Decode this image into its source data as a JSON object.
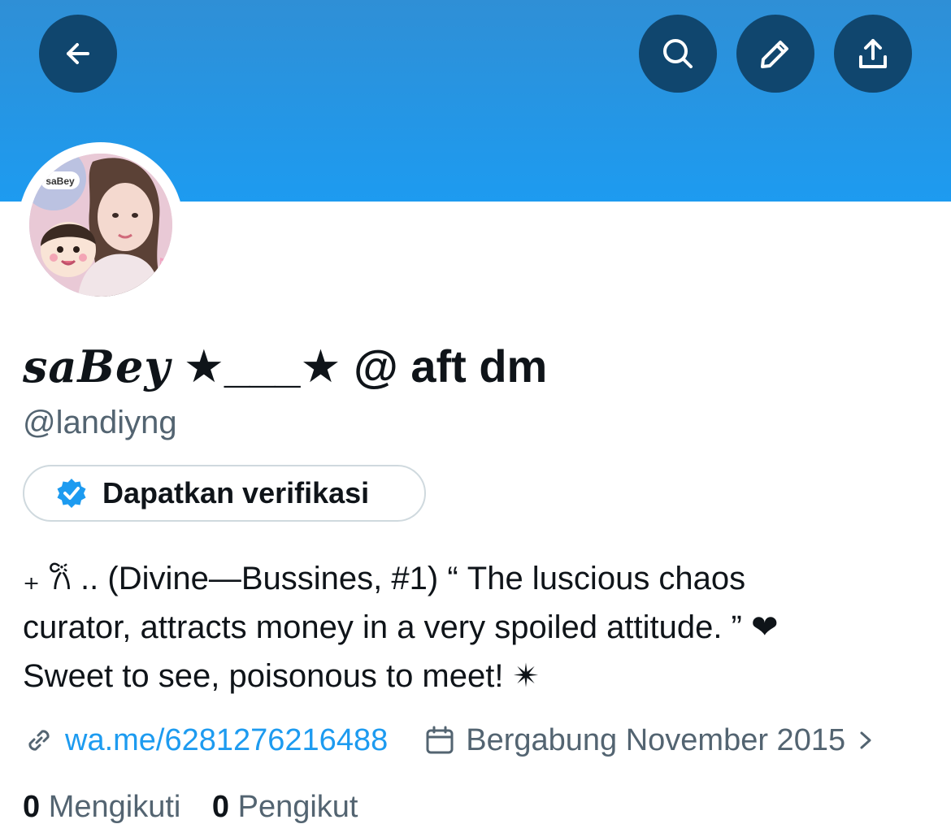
{
  "header": {
    "back_icon": "arrow-left-icon",
    "search_icon": "search-icon",
    "edit_icon": "pencil-icon",
    "share_icon": "share-upload-icon",
    "banner_color": "#1d9bf0",
    "button_color": "#10466e"
  },
  "profile": {
    "avatar_text": "saBey",
    "display_name_script": "saBey",
    "display_name_rest": "★___★ @ aft dm",
    "handle": "@landiyng",
    "verify_label": "Dapatkan verifikasi",
    "bio_lines": [
      "₊ 𐙚 .. (Divine—Bussines, #1) “ The luscious chaos",
      "curator, attracts money in a very spoiled attitude. ” ❤",
      "Sweet to see, poisonous to meet! ✴"
    ],
    "link": "wa.me/6281276216488",
    "joined": "Bergabung November 2015",
    "following_count": "0",
    "following_label": "Mengikuti",
    "followers_count": "0",
    "followers_label": "Pengikut"
  },
  "colors": {
    "accent": "#1d9bf0",
    "text": "#0f1419",
    "secondary": "#536471"
  }
}
